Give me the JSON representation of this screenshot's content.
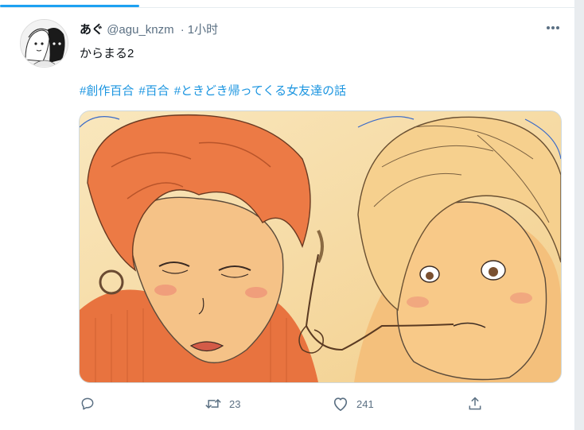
{
  "tweet": {
    "author_name": "あぐ",
    "author_handle": "@agu_knzm",
    "separator": "·",
    "timestamp": "1小时",
    "text": "からまる2",
    "hashtags": [
      "#創作百合",
      "#百合",
      "#ときどき帰ってくる女友達の話"
    ]
  },
  "actions": {
    "reply_count": "",
    "retweet_count": "23",
    "like_count": "241"
  },
  "icons": {
    "more": "more-dots-icon",
    "reply": "reply-icon",
    "retweet": "retweet-icon",
    "like": "heart-icon",
    "share": "share-icon"
  },
  "colors": {
    "accent": "#1da1f2",
    "hashtag": "#1b95e0",
    "secondary_text": "#5b7083"
  }
}
